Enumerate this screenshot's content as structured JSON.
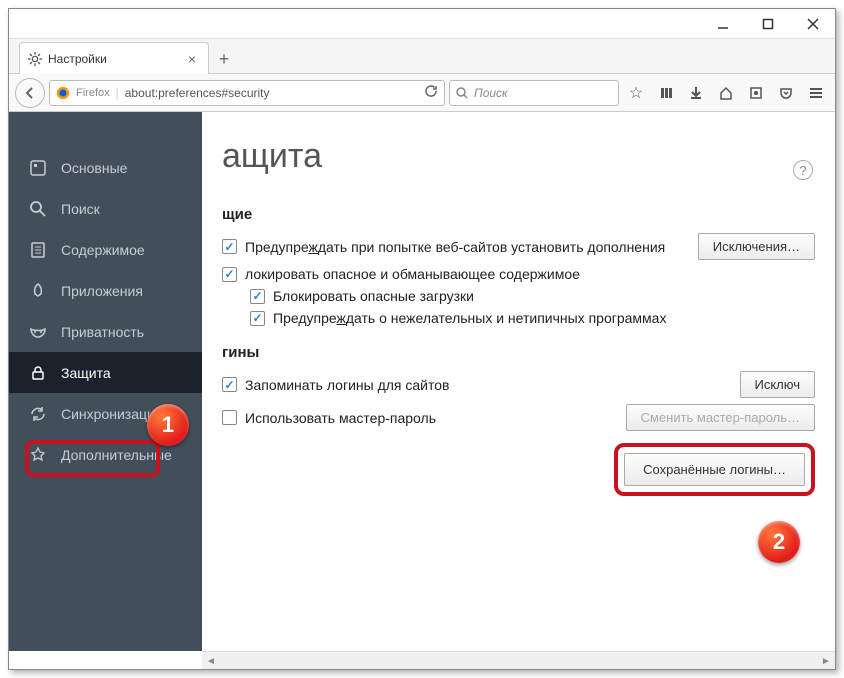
{
  "window": {
    "tab_title": "Настройки"
  },
  "urlbar": {
    "brand": "Firefox",
    "url": "about:preferences#security"
  },
  "searchbar": {
    "placeholder": "Поиск"
  },
  "sidebar": {
    "items": [
      {
        "label": "Основные"
      },
      {
        "label": "Поиск"
      },
      {
        "label": "Содержимое"
      },
      {
        "label": "Приложения"
      },
      {
        "label": "Приватность"
      },
      {
        "label": "Защита"
      },
      {
        "label": "Синхронизация"
      },
      {
        "label": "Дополнительные"
      }
    ]
  },
  "main": {
    "title": "ащита",
    "section_general": "щие",
    "warn_addons": "Предупреждать при попытке веб-сайтов установить дополнения",
    "exceptions_btn": "Исключения…",
    "block_dangerous": "локировать опасное и обманывающее содержимое",
    "block_downloads": "Блокировать опасные загрузки",
    "warn_unwanted": "Предупреждать о нежелательных и нетипичных программах",
    "section_logins": "гины",
    "remember_logins": "Запоминать логины для сайтов",
    "exceptions_btn2": "Исключ",
    "use_master": "Использовать мастер-пароль",
    "change_master_btn": "Сменить мастер-пароль…",
    "saved_logins_btn": "Сохранённые логины…"
  },
  "callouts": {
    "one": "1",
    "two": "2"
  }
}
